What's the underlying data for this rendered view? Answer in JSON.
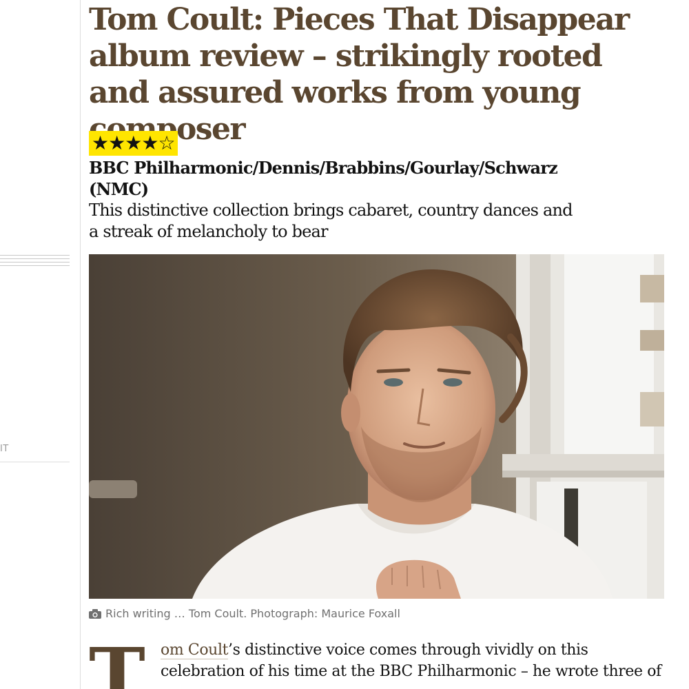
{
  "article": {
    "headline": "Tom Coult: Pieces That Disappear album review – strikingly rooted and assured works from young composer",
    "rating": {
      "value": 4,
      "max": 5,
      "filled_glyph": "★",
      "empty_glyph": "☆",
      "badge_color": "#ffe500"
    },
    "subheading": "BBC Philharmonic/Dennis/Brabbins/Gourlay/Schwarz (NMC)",
    "standfirst": "This distinctive collection brings cabaret, country dances and a streak of melancholy to bear",
    "image": {
      "icon": "camera-icon",
      "caption": "Rich writing … Tom Coult. Photograph: Maurice Foxall"
    },
    "body": {
      "dropcap": "T",
      "link_text": "om Coult",
      "text": "’s distinctive voice comes through vividly on this celebration of his time at the BBC Philharmonic – he wrote three of"
    }
  },
  "sidebar": {
    "fragment_text": "IT"
  },
  "colors": {
    "headline": "#5a4630",
    "text": "#121212",
    "caption": "#707070",
    "rule": "#dcdcdc"
  }
}
